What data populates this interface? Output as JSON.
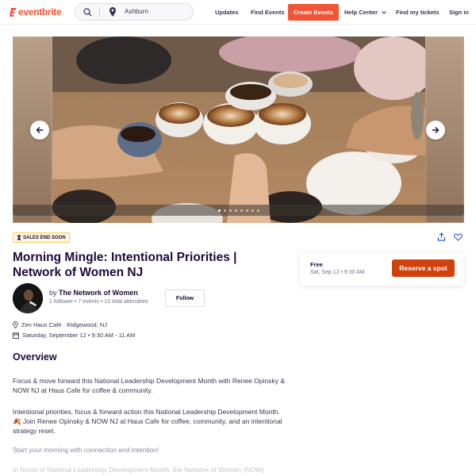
{
  "header": {
    "logo_text": "eventbrite",
    "search_location": "Ashburn",
    "nav": {
      "updates": "Updates",
      "find_events": "Find Events",
      "create_events": "Create Events",
      "help_center": "Help Center",
      "find_tickets": "Find my tickets",
      "sign_in": "Sign in"
    }
  },
  "hero": {
    "slide_count": 8,
    "active_slide": 1
  },
  "event": {
    "badge": "SALES END SOON",
    "title": "Morning Mingle: Intentional Priorities | Network of Women NJ",
    "organizer": {
      "by": "by",
      "name": "The Network of Women",
      "stats": "1 follower • 7 events • 13 total attendees",
      "follow_label": "Follow"
    },
    "location": "Zen Haus Café · Ridgewood, NJ",
    "datetime": "Saturday, September 12 • 9:30 AM - 11 AM"
  },
  "overview": {
    "heading": "Overview",
    "paragraphs": [
      "Focus & move forward this National Leadership Development Month with Renee Opinsky & NOW NJ at Haus Cafe for coffee & community.",
      "Intentional priorities, focus & forward action this National Leadership Development Month. 🍂 Join Renee Opinsky & NOW NJ at Haus Cafe for coffee, community, and an intentional strategy reset.",
      "Start your morning with connection and intention!",
      "In honor of National Leadership Development Month, the Network of Women (NOW)"
    ]
  },
  "ticket": {
    "price": "Free",
    "date": "Sat, Sep 12 • 9:30 AM",
    "reserve_label": "Reserve a spot"
  },
  "colors": {
    "brand": "#f05537",
    "reserve": "#d1410c",
    "text_dark": "#1e0a3c",
    "badge_bg": "#fff8db"
  }
}
